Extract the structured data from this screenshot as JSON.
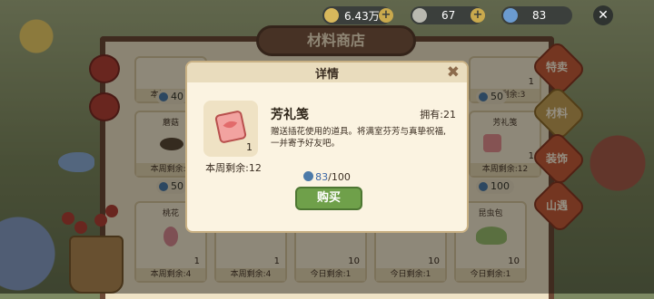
{
  "currency": [
    {
      "icon": "gold-coin-icon",
      "value": "6.43万"
    },
    {
      "icon": "silver-coin-icon",
      "value": "67"
    },
    {
      "icon": "blue-moon-icon",
      "value": "83"
    }
  ],
  "shop": {
    "title": "材料商店"
  },
  "side_tabs": [
    "特卖",
    "材料",
    "装饰",
    "山遇"
  ],
  "grid": {
    "top_row": [
      {
        "left": "本周剩余:1",
        "price": "40",
        "qty": ""
      },
      {
        "left": "",
        "price": "",
        "qty": ""
      },
      {
        "left": "本周剩余:3",
        "price": "50",
        "qty": "1"
      }
    ],
    "middle_row": [
      {
        "name": "蘑菇",
        "left": "本周剩余:1",
        "price": "50",
        "qty": ""
      },
      {
        "name": "芳礼笺",
        "left": "本周剩余:12",
        "price": "100",
        "qty": "1"
      }
    ],
    "bottom_row": [
      {
        "name": "桃花",
        "qty": "1",
        "left": "本周剩余:4"
      },
      {
        "name": "",
        "qty": "1",
        "left": "本周剩余:4"
      },
      {
        "name": "",
        "qty": "10",
        "left": "今日剩余:1"
      },
      {
        "name": "",
        "qty": "10",
        "left": "今日剩余:1"
      },
      {
        "name": "昆虫包",
        "qty": "10",
        "left": "今日剩余:1"
      }
    ]
  },
  "modal": {
    "title": "详情",
    "item_name": "芳礼笺",
    "item_qty": "1",
    "remain": "本周剩余:12",
    "owned": "拥有:21",
    "description": "赠送插花使用的道具。将满室芬芳与真挚祝福,一并寄予好友吧。",
    "cost_have": "83",
    "cost_total": "/100",
    "buy_label": "购买"
  }
}
